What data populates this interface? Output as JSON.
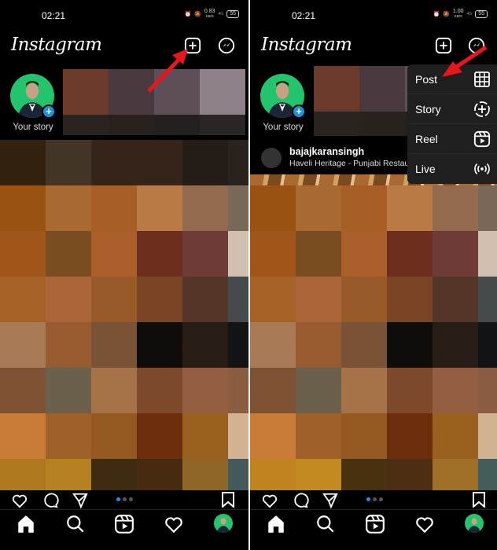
{
  "screens": [
    {
      "status": {
        "time": "02:21",
        "speed": "0.83",
        "speed_unit": "KB/S",
        "network": "4G",
        "battery": "55"
      },
      "header": {
        "logo": "Instagram"
      },
      "stories": {
        "your_story_label": "Your story"
      },
      "annotation": "arrow pointing to new post (+) button"
    },
    {
      "status": {
        "time": "02:21",
        "speed": "1.00",
        "speed_unit": "KB/S",
        "network": "4G",
        "battery": "55"
      },
      "header": {
        "logo": "Instagram"
      },
      "stories": {
        "your_story_label": "Your story"
      },
      "post": {
        "username": "bajajkaransingh",
        "location": "Haveli Heritage - Punjabi Restau"
      },
      "create_menu": {
        "items": [
          {
            "label": "Post",
            "icon": "grid-icon"
          },
          {
            "label": "Story",
            "icon": "story-add-icon"
          },
          {
            "label": "Reel",
            "icon": "reel-icon"
          },
          {
            "label": "Live",
            "icon": "live-icon"
          }
        ]
      },
      "annotation": "arrow pointing to Post menu item"
    }
  ],
  "colors": {
    "accent_blue": "#1e90e8",
    "avatar_green": "#24c46d",
    "annotation_red": "#e8161a",
    "menu_bg": "#1f1f1f"
  },
  "story_thumbs": [
    "#6b3a2a",
    "#4a3a40",
    "#5e4e58",
    "#8e8088",
    "#2a2420",
    "#28221f",
    "#252020",
    "#2a2624"
  ],
  "feed_tiles_left": [
    "#33210f",
    "#433428",
    "#34241a",
    "#34241a",
    "#241c17",
    "#2a221d",
    "#9a5212",
    "#a96a32",
    "#a85e27",
    "#b97a45",
    "#946a4e",
    "#7a6858",
    "#a0561a",
    "#7a4d20",
    "#aa5e2a",
    "#6e2e1e",
    "#703c38",
    "#d2c0b0",
    "#a66226",
    "#aa6638",
    "#995a2a",
    "#7a4425",
    "#543629",
    "#454a4c",
    "#a87a55",
    "#985a30",
    "#7a5235",
    "#0f0c09",
    "#281d15",
    "#111314",
    "#7e5233",
    "#6b604c",
    "#a67248",
    "#7d4a2b",
    "#935f40",
    "#8a5c42",
    "#c97c38",
    "#a0602a",
    "#955820",
    "#6d2d0a",
    "#9a6020",
    "#d2b492",
    "#b0781e",
    "#b48020",
    "#3e2b10",
    "#472b10",
    "#8f6628",
    "#445a5a"
  ],
  "feed_tiles_right": [
    "#9a5212",
    "#a96a32",
    "#a85e27",
    "#b97a45",
    "#946a4e",
    "#7a6858",
    "#a0561a",
    "#7a4d20",
    "#aa5e2a",
    "#6e2e1e",
    "#703c38",
    "#d2c0b0",
    "#a66226",
    "#aa6638",
    "#995a2a",
    "#7a4425",
    "#543629",
    "#454a4c",
    "#a87a55",
    "#985a30",
    "#7a5235",
    "#0f0c09",
    "#281d15",
    "#111314",
    "#7e5233",
    "#6b604c",
    "#a67248",
    "#7d4a2b",
    "#935f40",
    "#8a5c42",
    "#c97c38",
    "#a0602a",
    "#955820",
    "#6d2d0a",
    "#9a6020",
    "#d2b492",
    "#c0821e",
    "#c48a22",
    "#4a3210",
    "#4d2e12",
    "#a07028",
    "#445e5c"
  ]
}
